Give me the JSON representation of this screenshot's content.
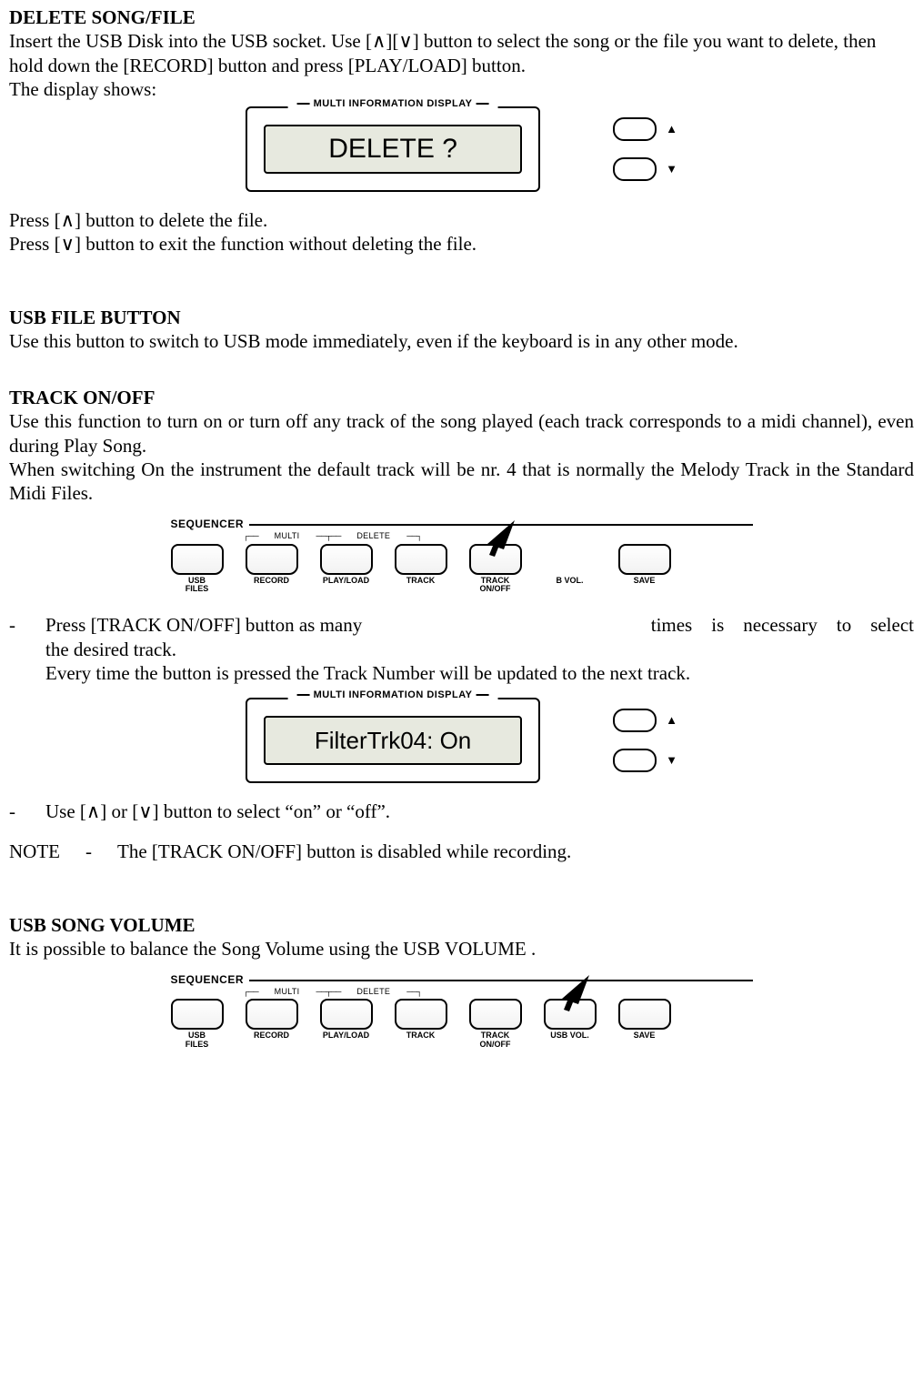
{
  "sections": {
    "delete": {
      "title": "DELETE SONG/FILE",
      "p1": "Insert the USB Disk into the USB socket. Use [∧][∨] button to select the song or the file you want to delete, then hold down the [RECORD] button and press [PLAY/LOAD] button.",
      "p2": "The display shows:",
      "p3": "Press [∧] button to delete the file.",
      "p4": "Press [∨] button to exit the function without deleting the file."
    },
    "usbfile": {
      "title": "USB FILE BUTTON",
      "p1": "Use this button to switch to USB mode immediately, even if the keyboard is in any other mode."
    },
    "trackonoff": {
      "title": "TRACK ON/OFF",
      "p1": "Use this function to turn on or turn off any track of the song played (each track corresponds to a midi channel), even during Play Song.",
      "p2": "When switching On the instrument    the default track will be nr. 4 that is normally the Melody Track in the Standard Midi Files.",
      "li1a": "Press [TRACK ON/OFF] button as many",
      "li1b": "times    is    necessary    to    select",
      "li1c": "the desired track.",
      "li1d": "Every time the button is pressed the Track Number will be updated to the next track.",
      "li2": "Use [∧] or [∨] button to select “on” or “off”.",
      "note_label": "NOTE",
      "note_dash": "-",
      "note_text": "The [TRACK ON/OFF] button is disabled while recording."
    },
    "usbvol": {
      "title": "USB SONG VOLUME",
      "p1": "It is possible to balance the Song Volume using the USB VOLUME ."
    }
  },
  "display": {
    "panel_label": "MULTI INFORMATION DISPLAY",
    "delete_text": "DELETE ?",
    "filter_text": "FilterTrk04: On",
    "up": "▲",
    "down": "▼"
  },
  "sequencer": {
    "title": "SEQUENCER",
    "sub_multi": "MULTI",
    "sub_delete": "DELETE",
    "buttons": {
      "usb_files": "USB\nFILES",
      "record": "RECORD",
      "playload": "PLAY/LOAD",
      "track": "TRACK",
      "track_onoff": "TRACK\nON/OFF",
      "usb_vol": "USB VOL.",
      "usb_vol_hidden": "B VOL.",
      "save": "SAVE"
    }
  }
}
